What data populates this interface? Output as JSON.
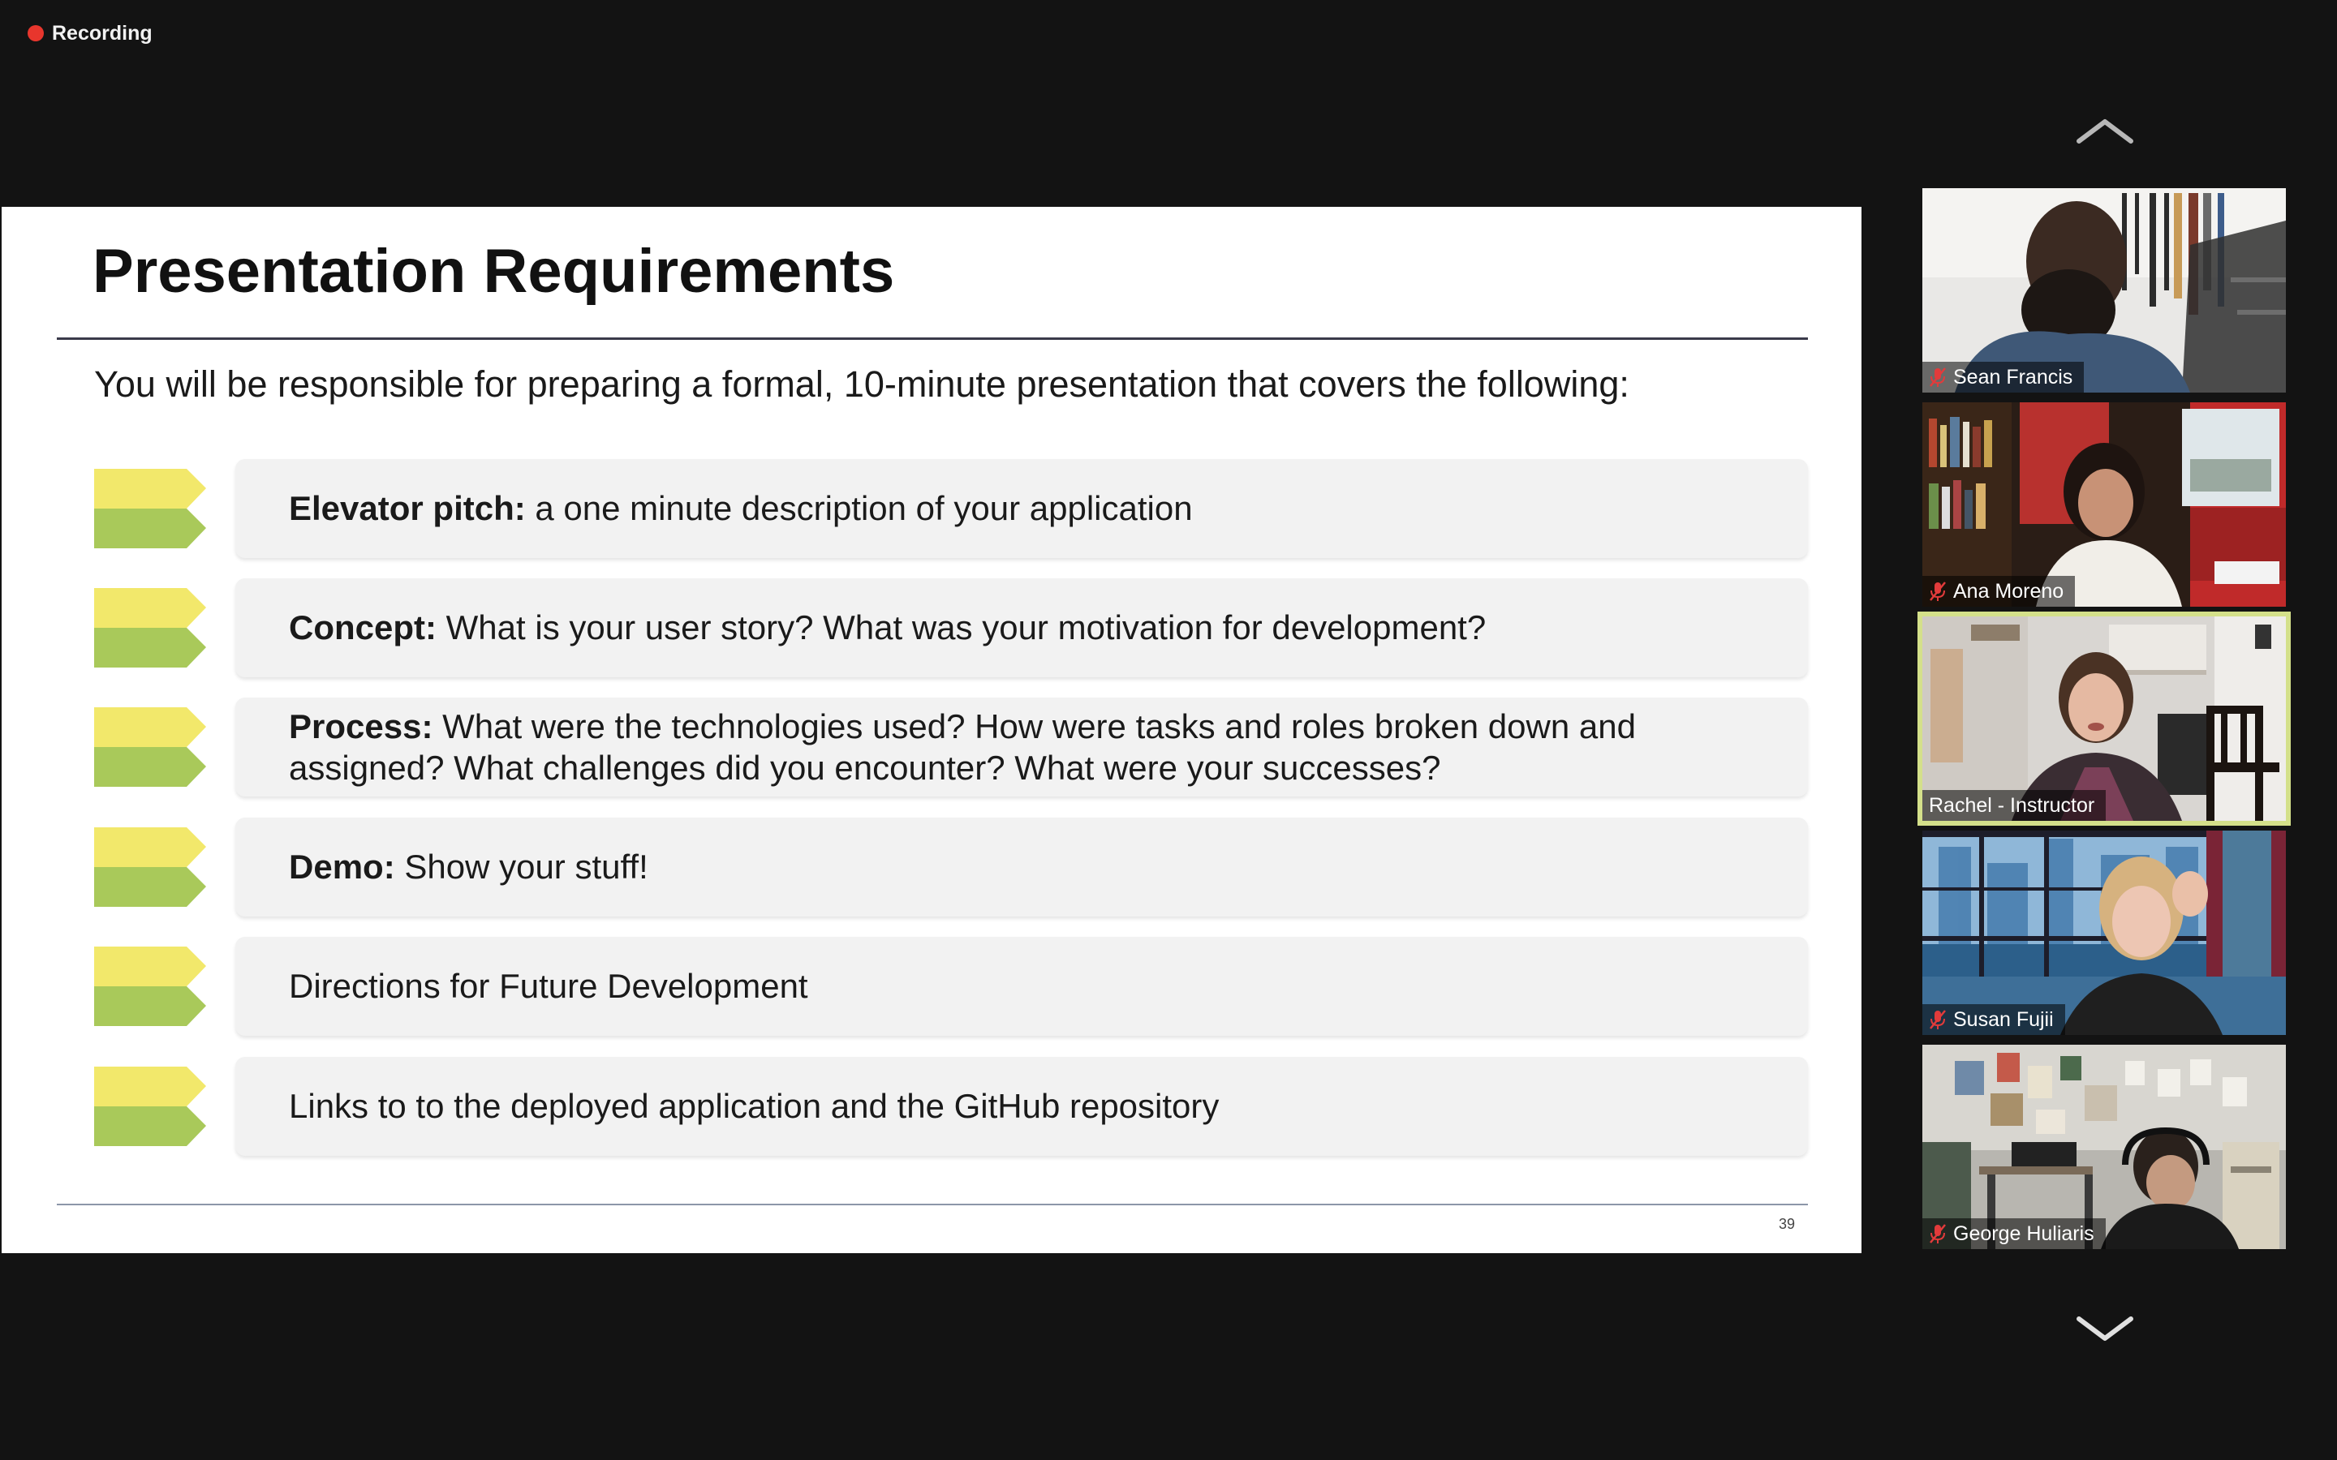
{
  "recording": {
    "label": "Recording",
    "dot_color": "#e8362d"
  },
  "slide": {
    "title": "Presentation Requirements",
    "intro": "You will be responsible for preparing a formal, 10-minute presentation that covers the following:",
    "items": [
      {
        "bold": "Elevator pitch:",
        "text": " a one minute description of your application"
      },
      {
        "bold": "Concept:",
        "text": " What is your user story? What was your motivation for development?"
      },
      {
        "bold": "Process:",
        "text": " What were the technologies used? How were tasks and roles broken down and assigned? What challenges did you encounter? What were your successes?"
      },
      {
        "bold": "Demo:",
        "text": " Show your stuff!"
      },
      {
        "bold": "",
        "text": "Directions for Future Development"
      },
      {
        "bold": "",
        "text": "Links to to the deployed application and the GitHub repository"
      }
    ],
    "page_number": "39",
    "icon": "yellow-green-chevron-icon",
    "colors": {
      "arrow_top": "#f2e86b",
      "arrow_bottom": "#a9c95a",
      "card": "#f2f2f2"
    }
  },
  "gallery": {
    "scroll_up_icon": "chevron-up-icon",
    "scroll_down_icon": "chevron-down-icon",
    "active_speaker_color": "#d4e08a",
    "participants": [
      {
        "name": "Sean Francis",
        "muted": true,
        "active": false,
        "video": "man-with-beard-icon"
      },
      {
        "name": "Ana Moreno",
        "muted": true,
        "active": false,
        "video": "woman-at-desk-icon"
      },
      {
        "name": "Rachel - Instructor",
        "muted": false,
        "active": true,
        "video": "woman-speaking-icon"
      },
      {
        "name": "Susan Fujii",
        "muted": true,
        "active": false,
        "video": "woman-by-window-icon"
      },
      {
        "name": "George Huliaris",
        "muted": true,
        "active": false,
        "video": "man-with-headphones-icon"
      }
    ]
  }
}
